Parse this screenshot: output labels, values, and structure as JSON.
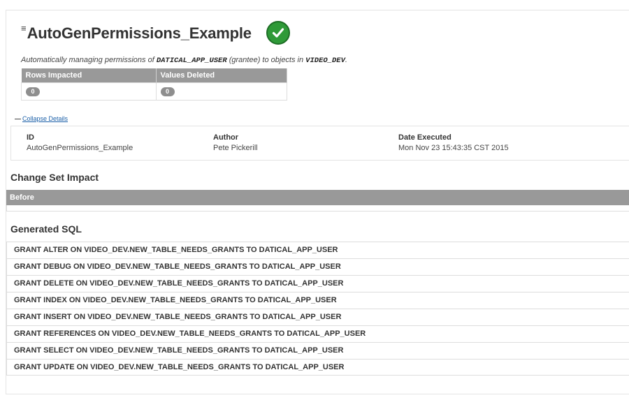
{
  "changeset": {
    "menu_icon": "hamburger-icon",
    "title": "AutoGenPermissions_Example",
    "status_icon": "check-icon",
    "status_color": "#2f9a38",
    "description": {
      "prefix": "Automatically managing permissions of",
      "grantee": "DATICAL_APP_USER",
      "middle": "(grantee) to objects in",
      "schema": "VIDEO_DEV",
      "suffix": "."
    }
  },
  "stats": {
    "headers": [
      "Rows Impacted",
      "Values Deleted"
    ],
    "values": [
      "0",
      "0"
    ]
  },
  "collapse": {
    "symbol": "—",
    "label": "Collapse Details"
  },
  "details": {
    "id_label": "ID",
    "id_value": "AutoGenPermissions_Example",
    "author_label": "Author",
    "author_value": "Pete Pickerill",
    "date_label": "Date Executed",
    "date_value": "Mon Nov 23 15:43:35 CST 2015"
  },
  "impact": {
    "heading": "Change Set Impact",
    "before_label": "Before"
  },
  "sql": {
    "heading": "Generated SQL",
    "statements": [
      "GRANT ALTER ON VIDEO_DEV.NEW_TABLE_NEEDS_GRANTS TO DATICAL_APP_USER",
      "GRANT DEBUG ON VIDEO_DEV.NEW_TABLE_NEEDS_GRANTS TO DATICAL_APP_USER",
      "GRANT DELETE ON VIDEO_DEV.NEW_TABLE_NEEDS_GRANTS TO DATICAL_APP_USER",
      "GRANT INDEX ON VIDEO_DEV.NEW_TABLE_NEEDS_GRANTS TO DATICAL_APP_USER",
      "GRANT INSERT ON VIDEO_DEV.NEW_TABLE_NEEDS_GRANTS TO DATICAL_APP_USER",
      "GRANT REFERENCES ON VIDEO_DEV.NEW_TABLE_NEEDS_GRANTS TO DATICAL_APP_USER",
      "GRANT SELECT ON VIDEO_DEV.NEW_TABLE_NEEDS_GRANTS TO DATICAL_APP_USER",
      "GRANT UPDATE ON VIDEO_DEV.NEW_TABLE_NEEDS_GRANTS TO DATICAL_APP_USER"
    ]
  }
}
